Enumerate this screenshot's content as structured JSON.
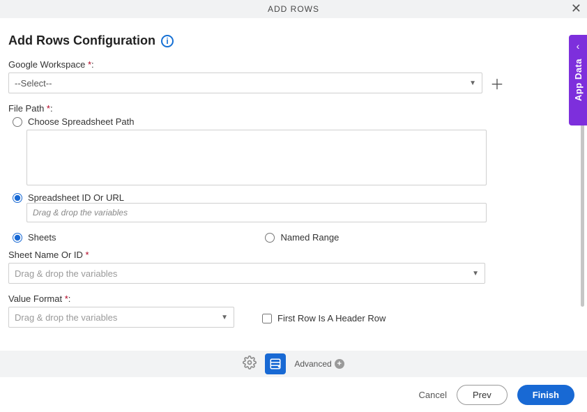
{
  "modal": {
    "title": "ADD ROWS",
    "close_icon": "close-icon"
  },
  "header": {
    "title": "Add Rows Configuration"
  },
  "googleWorkspace": {
    "label": "Google Workspace ",
    "required": "*",
    "colon": ":",
    "selected": "--Select--"
  },
  "filePath": {
    "label": "File Path ",
    "required": "*",
    "colon": ":",
    "options": {
      "choose": {
        "label": "Choose Spreadsheet Path",
        "selected": false
      },
      "idurl": {
        "label": "Spreadsheet ID Or URL",
        "selected": true,
        "placeholder": "Drag & drop the variables"
      }
    }
  },
  "rangeType": {
    "sheets": {
      "label": "Sheets",
      "selected": true
    },
    "named": {
      "label": "Named Range",
      "selected": false
    }
  },
  "sheetName": {
    "label": "Sheet Name Or ID ",
    "required": "*",
    "placeholder": "Drag & drop the variables"
  },
  "valueFormat": {
    "label": "Value Format ",
    "required": "*",
    "colon": ":",
    "placeholder": "Drag & drop the variables"
  },
  "headerRow": {
    "label": "First Row Is A Header Row",
    "checked": false
  },
  "toolbar": {
    "advanced_label": "Advanced"
  },
  "footer": {
    "cancel": "Cancel",
    "prev": "Prev",
    "finish": "Finish"
  },
  "sideTab": {
    "label": "App Data"
  }
}
